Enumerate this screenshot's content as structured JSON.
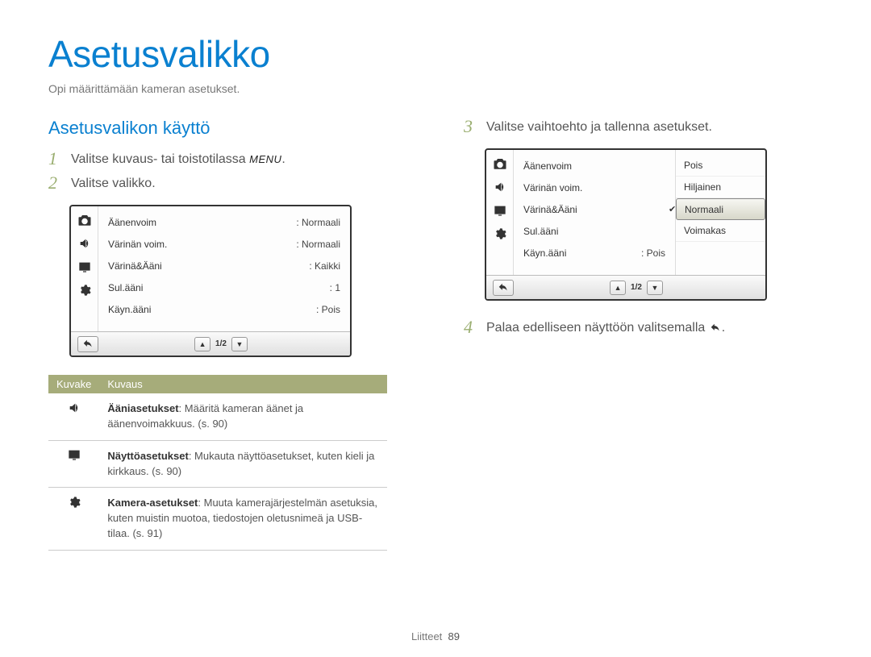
{
  "page": {
    "title": "Asetusvalikko",
    "subtitle": "Opi määrittämään kameran asetukset.",
    "section": "Asetusvalikon käyttö",
    "footer_label": "Liitteet",
    "footer_page": "89"
  },
  "steps": {
    "s1_num": "1",
    "s1_text_a": "Valitse kuvaus- tai toistotilassa ",
    "s1_menu": "MENU",
    "s1_text_b": ".",
    "s2_num": "2",
    "s2_text": "Valitse valikko.",
    "s3_num": "3",
    "s3_text": "Valitse vaihtoehto ja tallenna asetukset.",
    "s4_num": "4",
    "s4_text_a": "Palaa edelliseen näyttöön valitsemalla ",
    "s4_text_b": "."
  },
  "cam_a": {
    "rows": [
      {
        "label": "Äänenvoim",
        "value": ": Normaali"
      },
      {
        "label": "Värinän voim.",
        "value": ": Normaali"
      },
      {
        "label": "Värinä&Ääni",
        "value": ": Kaikki"
      },
      {
        "label": "Sul.ääni",
        "value": ": 1"
      },
      {
        "label": "Käyn.ääni",
        "value": ": Pois"
      }
    ],
    "page_indicator": "1/2"
  },
  "cam_b": {
    "rows": [
      {
        "label": "Äänenvoim"
      },
      {
        "label": "Värinän voim."
      },
      {
        "label": "Värinä&Ääni"
      },
      {
        "label": "Sul.ääni"
      },
      {
        "label": "Käyn.ääni",
        "value": ": Pois"
      }
    ],
    "options": [
      {
        "label": "Pois",
        "selected": false
      },
      {
        "label": "Hiljainen",
        "selected": false
      },
      {
        "label": "Normaali",
        "selected": true
      },
      {
        "label": "Voimakas",
        "selected": false
      }
    ],
    "page_indicator": "1/2"
  },
  "desc": {
    "head_icon": "Kuvake",
    "head_desc": "Kuvaus",
    "rows": [
      {
        "icon": "sound-icon",
        "title": "Ääniasetukset",
        "text": ": Määritä kameran äänet ja äänenvoimakkuus. (s. 90)"
      },
      {
        "icon": "display-icon",
        "title": "Näyttöasetukset",
        "text": ": Mukauta näyttöasetukset, kuten kieli ja kirkkaus. (s. 90)"
      },
      {
        "icon": "gear-icon",
        "title": "Kamera-asetukset",
        "text": ": Muuta kamerajärjestelmän asetuksia, kuten muistin muotoa, tiedostojen oletusnimeä ja USB-tilaa. (s. 91)"
      }
    ]
  }
}
